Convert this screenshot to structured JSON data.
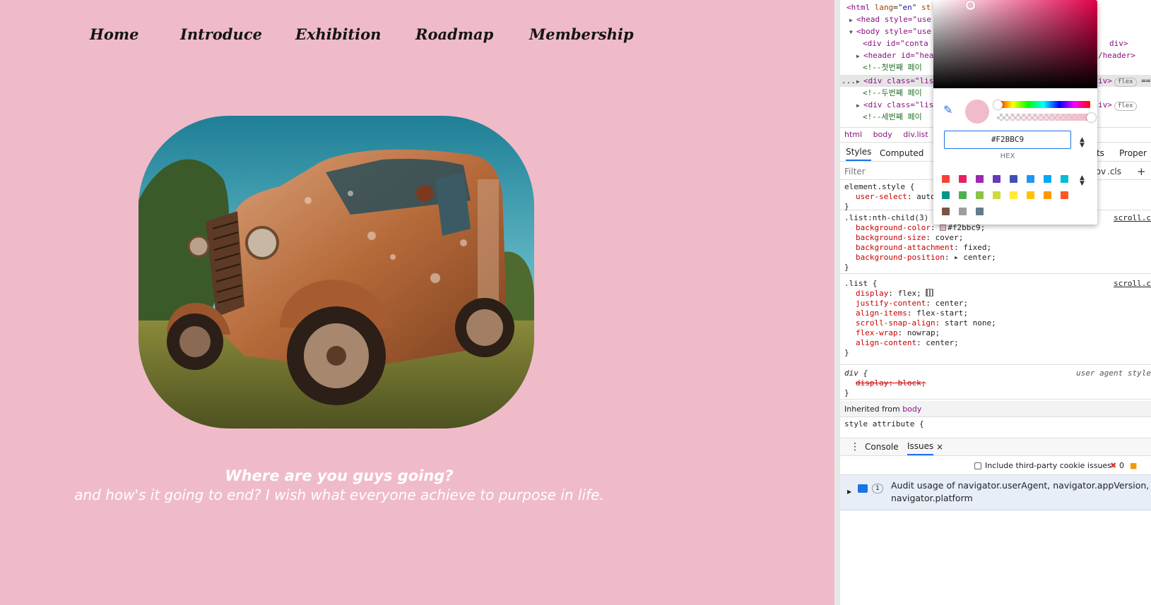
{
  "site": {
    "nav": [
      "Home",
      "Introduce",
      "Exhibition",
      "Roadmap",
      "Membership"
    ],
    "heading": "Where are you guys going?",
    "subtext": "and how's it going to end? I wish what everyone achieve to purpose in life.",
    "background_color": "#f0bbc9"
  },
  "devtools": {
    "dom": {
      "line1_tag": "<html",
      "line1_attr": "lang",
      "line1_val": "\"en\"",
      "line1_tail": "st",
      "head": "<head style=\"use",
      "body": "<body style=\"use",
      "container": "<div id=\"conta",
      "container_end": "div>",
      "header": "<header id=\"hea",
      "header_end": "/header>",
      "comment1": "<!--첫번째 페이",
      "list1": "<div class=\"lis",
      "list1_end": "iv>",
      "list1_badge": "flex",
      "list1_eq": "==",
      "comment2": "<!--두번째 페이",
      "list2": "<div class=\"lis",
      "list2_end": "iv>",
      "list2_badge": "flex",
      "comment3": "<!--세번째 페이",
      "ellipsis": "..."
    },
    "breadcrumbs": [
      "html",
      "body",
      "div.list"
    ],
    "panel_tabs": [
      "Styles",
      "Computed",
      "ints",
      "Proper"
    ],
    "filter_placeholder": "Filter",
    "filter_hov": ":hov",
    "filter_cls": ".cls",
    "filter_add": "+",
    "rules": {
      "element_style": {
        "selector": "element.style {",
        "decls": [
          {
            "prop": "user-select",
            "val": "auto"
          }
        ]
      },
      "nth_child": {
        "selector": ".list:nth-child(3) {",
        "source": "scroll.c",
        "decls": [
          {
            "prop": "background-color",
            "val": "#f2bbc9;"
          },
          {
            "prop": "background-size",
            "val": "cover;"
          },
          {
            "prop": "background-attachment",
            "val": "fixed;"
          },
          {
            "prop": "background-position",
            "val": "▸ center;"
          }
        ]
      },
      "list": {
        "selector": ".list {",
        "source": "scroll.c",
        "decls": [
          {
            "prop": "display",
            "val": "flex;"
          },
          {
            "prop": "justify-content",
            "val": "center;"
          },
          {
            "prop": "align-items",
            "val": "flex-start;"
          },
          {
            "prop": "scroll-snap-align",
            "val": "start none;"
          },
          {
            "prop": "flex-wrap",
            "val": "nowrap;"
          },
          {
            "prop": "align-content",
            "val": "center;"
          }
        ]
      },
      "div_ua": {
        "selector": "div {",
        "source": "user agent style",
        "decl": "display: block;"
      },
      "close": "}"
    },
    "inherited_label": "Inherited from",
    "inherited_from": "body",
    "style_attribute": "style attribute {",
    "drawer_tabs": [
      "Console",
      "Issues"
    ],
    "issues_close": "×",
    "third_party_label": "Include third-party cookie issues",
    "error_count": "0",
    "issue_count": "1",
    "issue_text_1": "Audit usage of navigator.userAgent, navigator.appVersion, a",
    "issue_text_2": "navigator.platform"
  },
  "color_picker": {
    "hex_value": "#F2BBC9",
    "format_label": "HEX",
    "current_color": "#f2bbc9",
    "swatch_colors": [
      "#f44336",
      "#e91e63",
      "#9c27b0",
      "#673ab7",
      "#3f51b5",
      "#2196f3",
      "#03a9f4",
      "#00bcd4",
      "#009688",
      "#4caf50",
      "#8bc34a",
      "#cddc39",
      "#ffeb3b",
      "#ffc107",
      "#ff9800",
      "#ff5722",
      "#795548",
      "#9e9e9e",
      "#607d8b"
    ]
  },
  "icons": [
    "eyedropper-icon",
    "format-stepper-icon",
    "palette-stepper-icon",
    "flex-editor-icon",
    "kebab-menu-icon",
    "issue-message-icon",
    "expand-triangle-icon",
    "close-icon"
  ]
}
